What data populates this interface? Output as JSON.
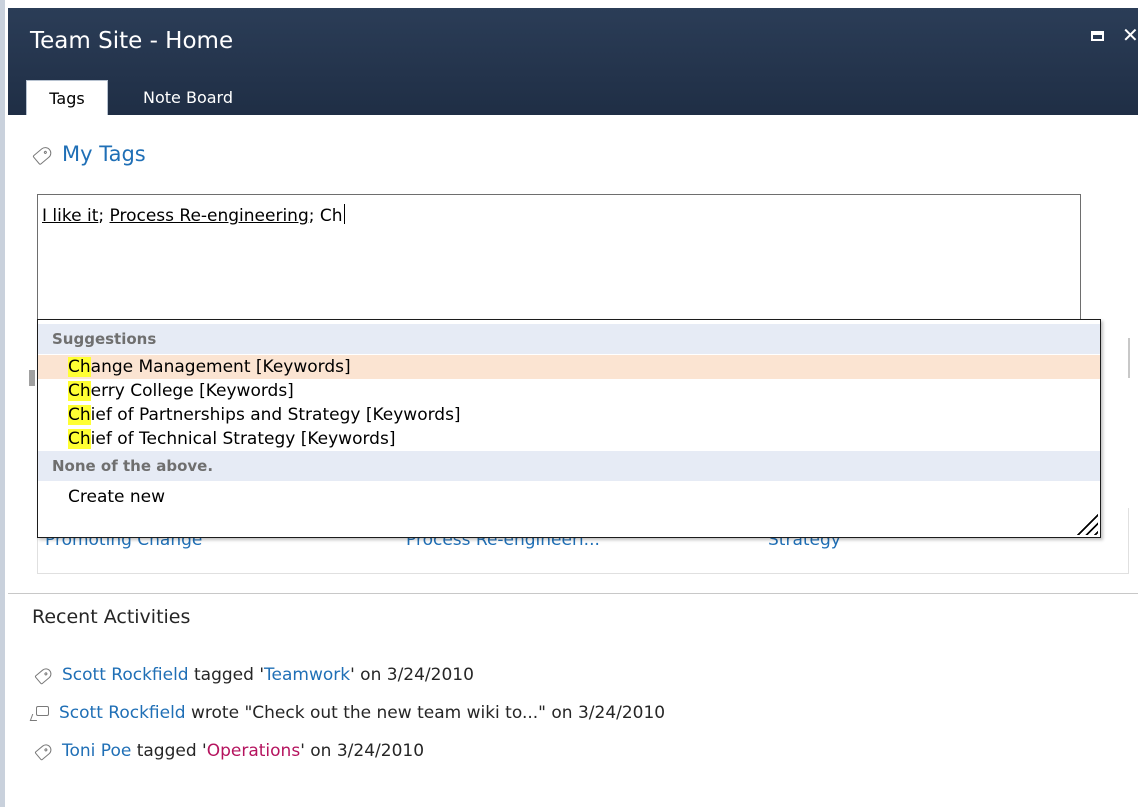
{
  "window": {
    "title": "Team Site - Home",
    "maximize_icon": "maximize-icon",
    "close_icon": "close-icon",
    "close_glyph": "✕"
  },
  "tabs": [
    {
      "label": "Tags",
      "active": true
    },
    {
      "label": "Note Board",
      "active": false
    }
  ],
  "my_tags": {
    "icon": "tag-icon",
    "heading": "My Tags",
    "input": {
      "tag1": "I like it",
      "sep1": "; ",
      "tag2": "Process Re-engineering",
      "sep2": "; ",
      "typed": "Ch"
    }
  },
  "suggestions": {
    "group_label": "Suggestions",
    "items": [
      {
        "match": "Ch",
        "rest": "ange Management [Keywords]"
      },
      {
        "match": "Ch",
        "rest": "erry College [Keywords]"
      },
      {
        "match": "Ch",
        "rest": "ief of Partnerships and Strategy [Keywords]"
      },
      {
        "match": "Ch",
        "rest": "ief of Technical Strategy [Keywords]"
      }
    ],
    "other_label": "None of the above.",
    "create_new": "Create new",
    "highlight_color": "#ffff33",
    "hover_color": "#fbe4d2"
  },
  "tag_cloud_partial": {
    "item1": "Promoting Change",
    "item2": "Process Re-engineeri...",
    "item3": "Strategy"
  },
  "recent_activities": {
    "heading": "Recent Activities",
    "items": [
      {
        "icon": "tag-icon",
        "user": "Scott Rockfield",
        "verb": " tagged '",
        "object": "Teamwork",
        "suffix": "' on 3/24/2010"
      },
      {
        "icon": "note-icon",
        "user": "Scott Rockfield",
        "verb": " wrote \"Check out the new team wiki to...\" on 3/24/2010"
      },
      {
        "icon": "tag-icon",
        "user": "Toni Poe",
        "verb": " tagged '",
        "object": "Operations",
        "suffix": "' on 3/24/2010"
      }
    ]
  },
  "colors": {
    "header_bg": "#1f2e45",
    "link": "#1f6fb6",
    "link_alt": "#b5135e"
  }
}
